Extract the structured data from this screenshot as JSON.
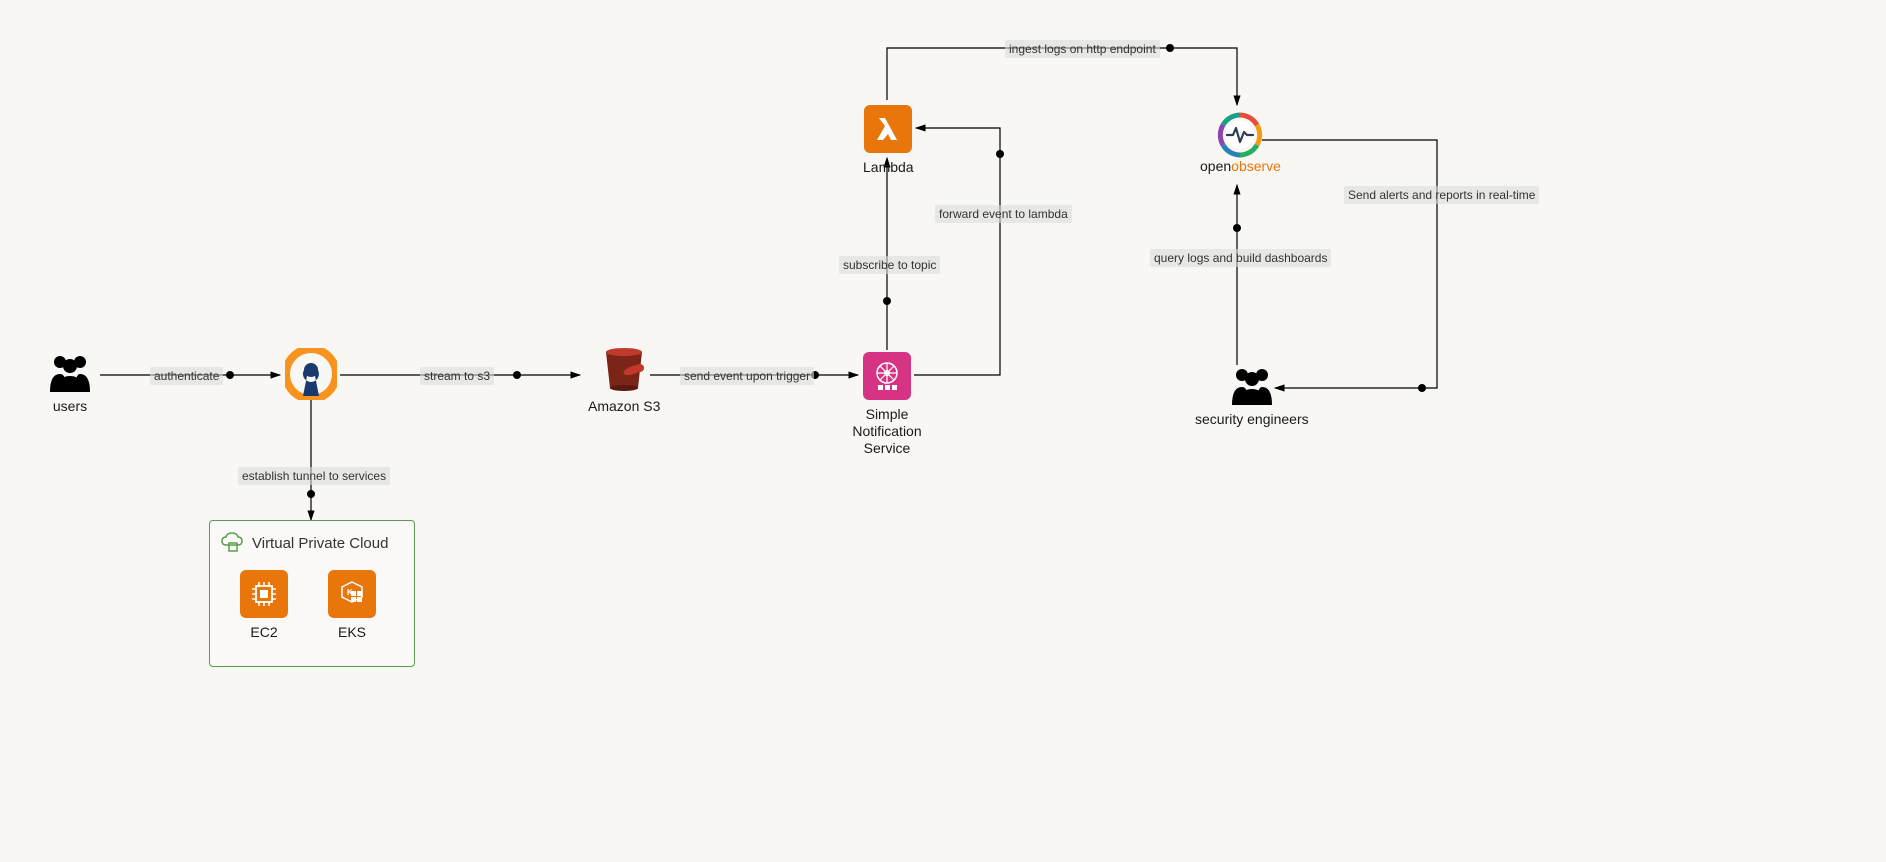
{
  "nodes": {
    "users": {
      "label": "users"
    },
    "vpn": {
      "label": ""
    },
    "s3": {
      "label": "Amazon S3"
    },
    "sns": {
      "label": "Simple\nNotification\nService"
    },
    "lambda": {
      "label": "Lambda"
    },
    "openobserve": {
      "brand_a": "open",
      "brand_b": "observe"
    },
    "sec_eng": {
      "label": "security engineers"
    },
    "vpc": {
      "title": "Virtual Private Cloud",
      "ec2": "EC2",
      "eks": "EKS"
    }
  },
  "edges": {
    "authenticate": "authenticate",
    "stream_s3": "stream to s3",
    "establish_tunnel": "establish tunnel to services",
    "send_event": "send event upon trigger",
    "subscribe": "subscribe to topic",
    "forward_lambda": "forward event to lambda",
    "ingest_logs": "ingest logs on http endpoint",
    "query_logs": "query logs and build dashboards",
    "send_alerts": "Send alerts and reports in real-time"
  }
}
